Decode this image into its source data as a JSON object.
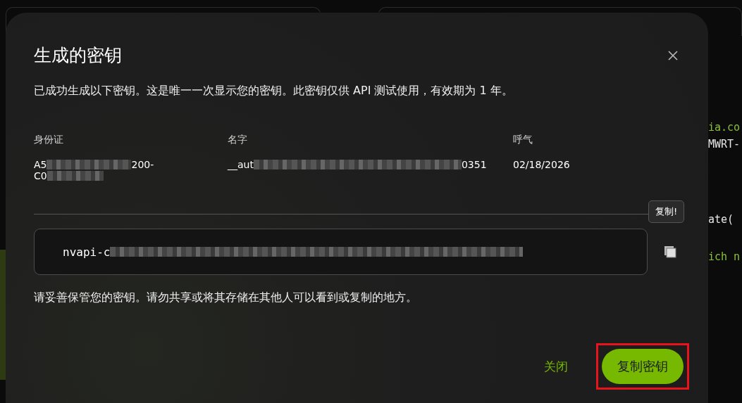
{
  "background_code": [
    {
      "text": "ia.co",
      "kind": "string"
    },
    {
      "text": "MWRT-",
      "kind": "plain"
    },
    {
      "text": "ate(",
      "kind": "plain"
    },
    {
      "text": "ich n",
      "kind": "string"
    }
  ],
  "dialog": {
    "title": "生成的密钥",
    "description": "已成功生成以下密钥。这是唯一一次显示您的密钥。此密钥仅供 API 测试使用，有效期为 1 年。",
    "columns": [
      {
        "label": "身份证",
        "lines": [
          [
            {
              "kind": "text",
              "text": "A5"
            },
            {
              "kind": "redacted"
            },
            {
              "kind": "text",
              "text": "200-"
            }
          ],
          [
            {
              "kind": "text",
              "text": "C0"
            },
            {
              "kind": "redacted"
            }
          ]
        ]
      },
      {
        "label": "名字",
        "lines": [
          [
            {
              "kind": "text",
              "text": "__aut"
            },
            {
              "kind": "redacted"
            },
            {
              "kind": "text",
              "text": "0351"
            }
          ]
        ]
      },
      {
        "label": "呼气",
        "lines": [
          [
            {
              "kind": "text",
              "text": "02/18/2026"
            }
          ]
        ]
      }
    ],
    "key": [
      {
        "kind": "text",
        "text": "nvapi-c"
      },
      {
        "kind": "redacted"
      }
    ],
    "tooltip": "复制!",
    "note": "请妥善保管您的密钥。请勿共享或将其存储在其他人可以看到或复制的地方。",
    "buttons": [
      {
        "label": "关闭",
        "kind": "link",
        "highlighted": false
      },
      {
        "label": "复制密钥",
        "kind": "primary",
        "highlighted": true
      }
    ]
  }
}
